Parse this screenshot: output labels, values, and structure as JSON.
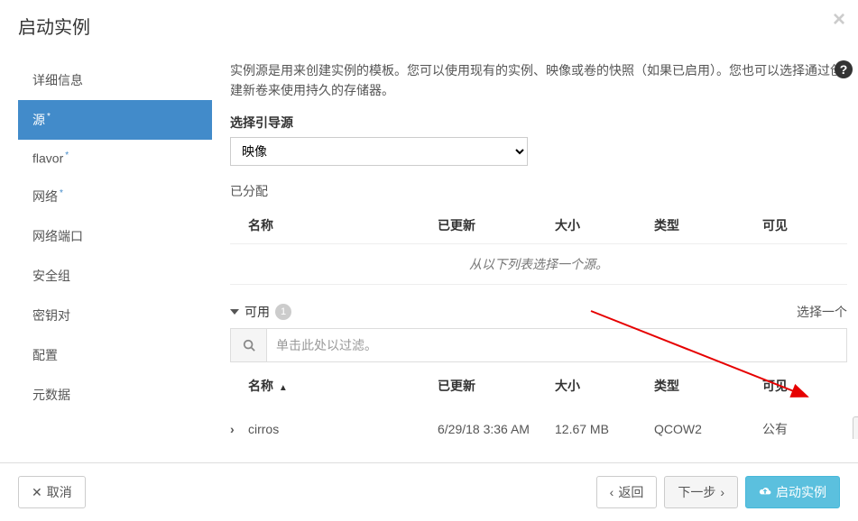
{
  "header": {
    "title": "启动实例"
  },
  "sidebar": {
    "items": [
      {
        "label": "详细信息",
        "required": false
      },
      {
        "label": "源",
        "required": true
      },
      {
        "label": "flavor",
        "required": true
      },
      {
        "label": "网络",
        "required": true
      },
      {
        "label": "网络端口",
        "required": false
      },
      {
        "label": "安全组",
        "required": false
      },
      {
        "label": "密钥对",
        "required": false
      },
      {
        "label": "配置",
        "required": false
      },
      {
        "label": "元数据",
        "required": false
      }
    ]
  },
  "content": {
    "description": "实例源是用来创建实例的模板。您可以使用现有的实例、映像或卷的快照（如果已启用）。您也可以选择通过创建新卷来使用持久的存储器。",
    "boot_source_label": "选择引导源",
    "boot_source_value": "映像",
    "allocated_label": "已分配",
    "columns": {
      "name": "名称",
      "updated": "已更新",
      "size": "大小",
      "type": "类型",
      "visible": "可见"
    },
    "empty_text": "从以下列表选择一个源。",
    "available_label": "可用",
    "available_count": "1",
    "select_one": "选择一个",
    "filter_placeholder": "单击此处以过滤。",
    "items": [
      {
        "name": "cirros",
        "updated": "6/29/18 3:36 AM",
        "size": "12.67 MB",
        "type": "QCOW2",
        "visible": "公有"
      }
    ]
  },
  "footer": {
    "cancel": "取消",
    "back": "返回",
    "next": "下一步",
    "launch": "启动实例"
  }
}
